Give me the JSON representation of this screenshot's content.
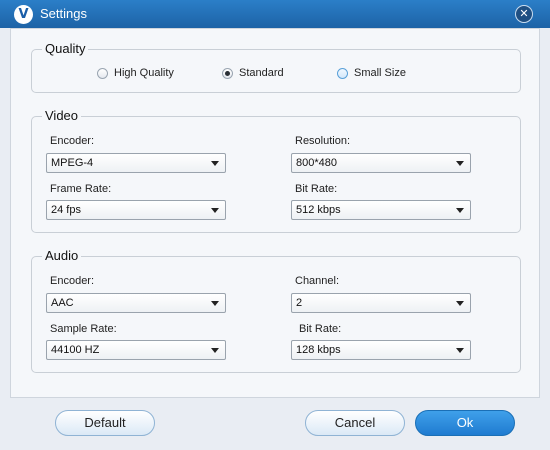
{
  "window": {
    "title": "Settings",
    "logo_letter": "V",
    "close_symbol": "✕"
  },
  "quality": {
    "title": "Quality",
    "options": [
      {
        "label": "High Quality",
        "selected": false
      },
      {
        "label": "Standard",
        "selected": true
      },
      {
        "label": "Small Size",
        "selected": false
      }
    ]
  },
  "video": {
    "title": "Video",
    "encoder": {
      "label": "Encoder:",
      "value": "MPEG-4"
    },
    "resolution": {
      "label": "Resolution:",
      "value": "800*480"
    },
    "frame_rate": {
      "label": "Frame Rate:",
      "value": "24 fps"
    },
    "bit_rate": {
      "label": "Bit Rate:",
      "value": "512 kbps"
    }
  },
  "audio": {
    "title": "Audio",
    "encoder": {
      "label": "Encoder:",
      "value": "AAC"
    },
    "channel": {
      "label": "Channel:",
      "value": "2"
    },
    "sample_rate": {
      "label": "Sample Rate:",
      "value": "44100 HZ"
    },
    "bit_rate": {
      "label": "Bit Rate:",
      "value": "128 kbps"
    }
  },
  "buttons": {
    "default": "Default",
    "cancel": "Cancel",
    "ok": "Ok"
  },
  "colors": {
    "titlebar": "#2b7fc8",
    "primary_button": "#2a88d8",
    "panel": "#f5f7fa"
  }
}
